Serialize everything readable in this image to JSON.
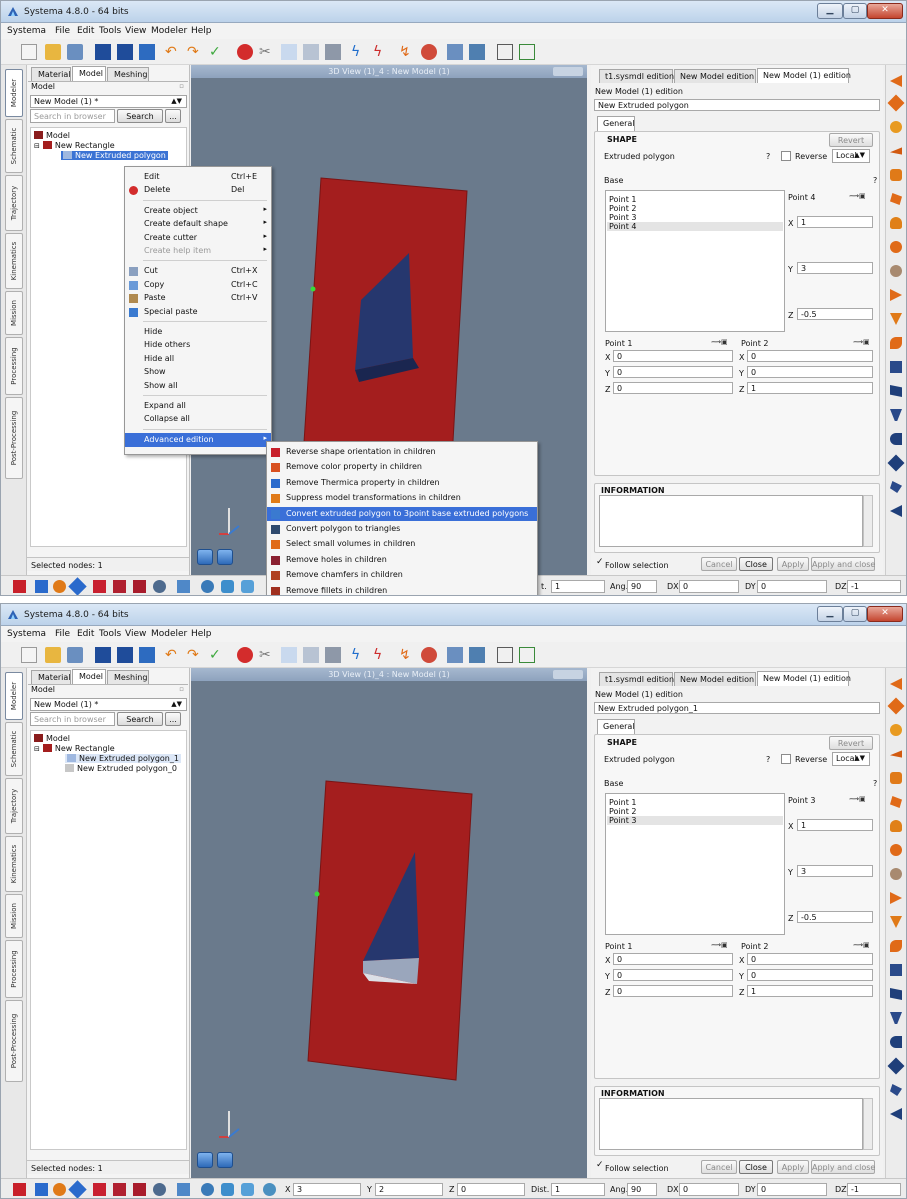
{
  "app": {
    "title": "Systema 4.8.0 - 64 bits",
    "menu": [
      "Systema",
      "File",
      "Edit",
      "Tools",
      "View",
      "Modeler",
      "Help"
    ],
    "vertical_tabs": [
      "Modeler",
      "Schematic",
      "Trajectory",
      "Kinematics",
      "Mission",
      "Processing",
      "Post-Processing"
    ],
    "colors": {
      "accent": "#3b73d4",
      "viewport_bg": "#6a7a8c",
      "panel_red": "#a41e1e",
      "polygon_blue": "#2a3d7a"
    }
  },
  "shot1": {
    "browser": {
      "tabs": [
        "Material",
        "Model",
        "Meshing"
      ],
      "header": "Model",
      "model_select": "New Model (1) *",
      "search_placeholder": "Search in browser",
      "search_button": "Search",
      "more_button": "...",
      "tree": [
        "Model",
        "New Rectangle",
        "New Extruded polygon"
      ],
      "status": "Selected nodes: 1"
    },
    "view_title": "3D View (1)_4 : New Model (1)",
    "editor": {
      "tabs": [
        "t1.sysmdl edition",
        "New Model edition",
        "New Model (1) edition"
      ],
      "header": "New Model (1) edition",
      "object_name": "New Extruded polygon",
      "general_tab": "General",
      "shape_label": "SHAPE",
      "revert": "Revert",
      "shape_type": "Extruded polygon",
      "help_mark": "?",
      "reverse_label": "Reverse",
      "frame": "Local",
      "base_label": "Base",
      "points": [
        "Point 1",
        "Point 2",
        "Point 3",
        "Point 4"
      ],
      "selected_point_label": "Point 4",
      "coord_x": "1",
      "coord_y": "3",
      "coord_z": "-0.5",
      "extrusion": {
        "p1_label": "Point 1",
        "p1": {
          "x": "0",
          "y": "0",
          "z": "0"
        },
        "p2_label": "Point 2",
        "p2": {
          "x": "0",
          "y": "0",
          "z": "1"
        }
      },
      "information_label": "INFORMATION",
      "follow_label": "Follow selection",
      "buttons": {
        "cancel": "Cancel",
        "close": "Close",
        "apply": "Apply",
        "apply_close": "Apply and close"
      }
    },
    "bottom": {
      "dist_label": "t.",
      "dist": "1",
      "ang_label": "Ang.",
      "ang": "90",
      "dx_label": "DX",
      "dx": "0",
      "dy_label": "DY",
      "dy": "0",
      "dz_label": "DZ",
      "dz": "-1"
    },
    "context_menu": [
      {
        "label": "Edit",
        "shortcut": "Ctrl+E",
        "icon": "none"
      },
      {
        "label": "Delete",
        "shortcut": "Del",
        "icon": "delete-icon"
      },
      {
        "sep": true
      },
      {
        "label": "Create object",
        "submenu": true
      },
      {
        "label": "Create default shape",
        "submenu": true
      },
      {
        "label": "Create cutter",
        "submenu": true
      },
      {
        "label": "Create help item",
        "submenu": true,
        "disabled": true
      },
      {
        "sep": true
      },
      {
        "label": "Cut",
        "shortcut": "Ctrl+X",
        "icon": "cut-icon"
      },
      {
        "label": "Copy",
        "shortcut": "Ctrl+C",
        "icon": "copy-icon"
      },
      {
        "label": "Paste",
        "shortcut": "Ctrl+V",
        "icon": "paste-icon"
      },
      {
        "label": "Special paste",
        "icon": "special-paste-icon"
      },
      {
        "sep": true
      },
      {
        "label": "Hide"
      },
      {
        "label": "Hide others"
      },
      {
        "label": "Hide all"
      },
      {
        "label": "Show"
      },
      {
        "label": "Show all"
      },
      {
        "sep": true
      },
      {
        "label": "Expand all"
      },
      {
        "label": "Collapse all"
      },
      {
        "sep": true
      },
      {
        "label": "Advanced edition",
        "submenu": true,
        "highlight": true
      }
    ],
    "submenu": [
      {
        "label": "Reverse shape orientation in children"
      },
      {
        "label": "Remove color property in children"
      },
      {
        "label": "Remove Thermica property in children"
      },
      {
        "label": "Suppress model transformations in children"
      },
      {
        "label": "Convert extruded polygon to 3point base extruded polygons",
        "highlight": true
      },
      {
        "label": "Convert polygon to triangles"
      },
      {
        "label": "Select small volumes in children"
      },
      {
        "label": "Remove holes in children"
      },
      {
        "label": "Remove chamfers in children"
      },
      {
        "label": "Remove fillets in children"
      }
    ]
  },
  "shot2": {
    "browser": {
      "tabs": [
        "Material",
        "Model",
        "Meshing"
      ],
      "header": "Model",
      "model_select": "New Model (1) *",
      "search_placeholder": "Search in browser",
      "search_button": "Search",
      "more_button": "...",
      "tree": [
        "Model",
        "New Rectangle",
        "New Extruded polygon_1",
        "New Extruded polygon_0"
      ],
      "status": "Selected nodes: 1"
    },
    "view_title": "3D View (1)_4 : New Model (1)",
    "editor": {
      "tabs": [
        "t1.sysmdl edition",
        "New Model edition",
        "New Model (1) edition"
      ],
      "header": "New Model (1) edition",
      "object_name": "New Extruded polygon_1",
      "general_tab": "General",
      "shape_label": "SHAPE",
      "revert": "Revert",
      "shape_type": "Extruded polygon",
      "help_mark": "?",
      "reverse_label": "Reverse",
      "frame": "Local",
      "base_label": "Base",
      "points": [
        "Point 1",
        "Point 2",
        "Point 3"
      ],
      "selected_point_label": "Point 3",
      "coord_x": "1",
      "coord_y": "3",
      "coord_z": "-0.5",
      "extrusion": {
        "p1_label": "Point 1",
        "p1": {
          "x": "0",
          "y": "0",
          "z": "0"
        },
        "p2_label": "Point 2",
        "p2": {
          "x": "0",
          "y": "0",
          "z": "1"
        }
      },
      "information_label": "INFORMATION",
      "follow_label": "Follow selection",
      "buttons": {
        "cancel": "Cancel",
        "close": "Close",
        "apply": "Apply",
        "apply_close": "Apply and close"
      }
    },
    "bottom": {
      "x_label": "X",
      "x": "3",
      "y_label": "Y",
      "y": "2",
      "z_label": "Z",
      "z": "0",
      "dist_label": "Dist.",
      "dist": "1",
      "ang_label": "Ang.",
      "ang": "90",
      "dx_label": "DX",
      "dx": "0",
      "dy_label": "DY",
      "dy": "0",
      "dz_label": "DZ",
      "dz": "-1"
    }
  }
}
